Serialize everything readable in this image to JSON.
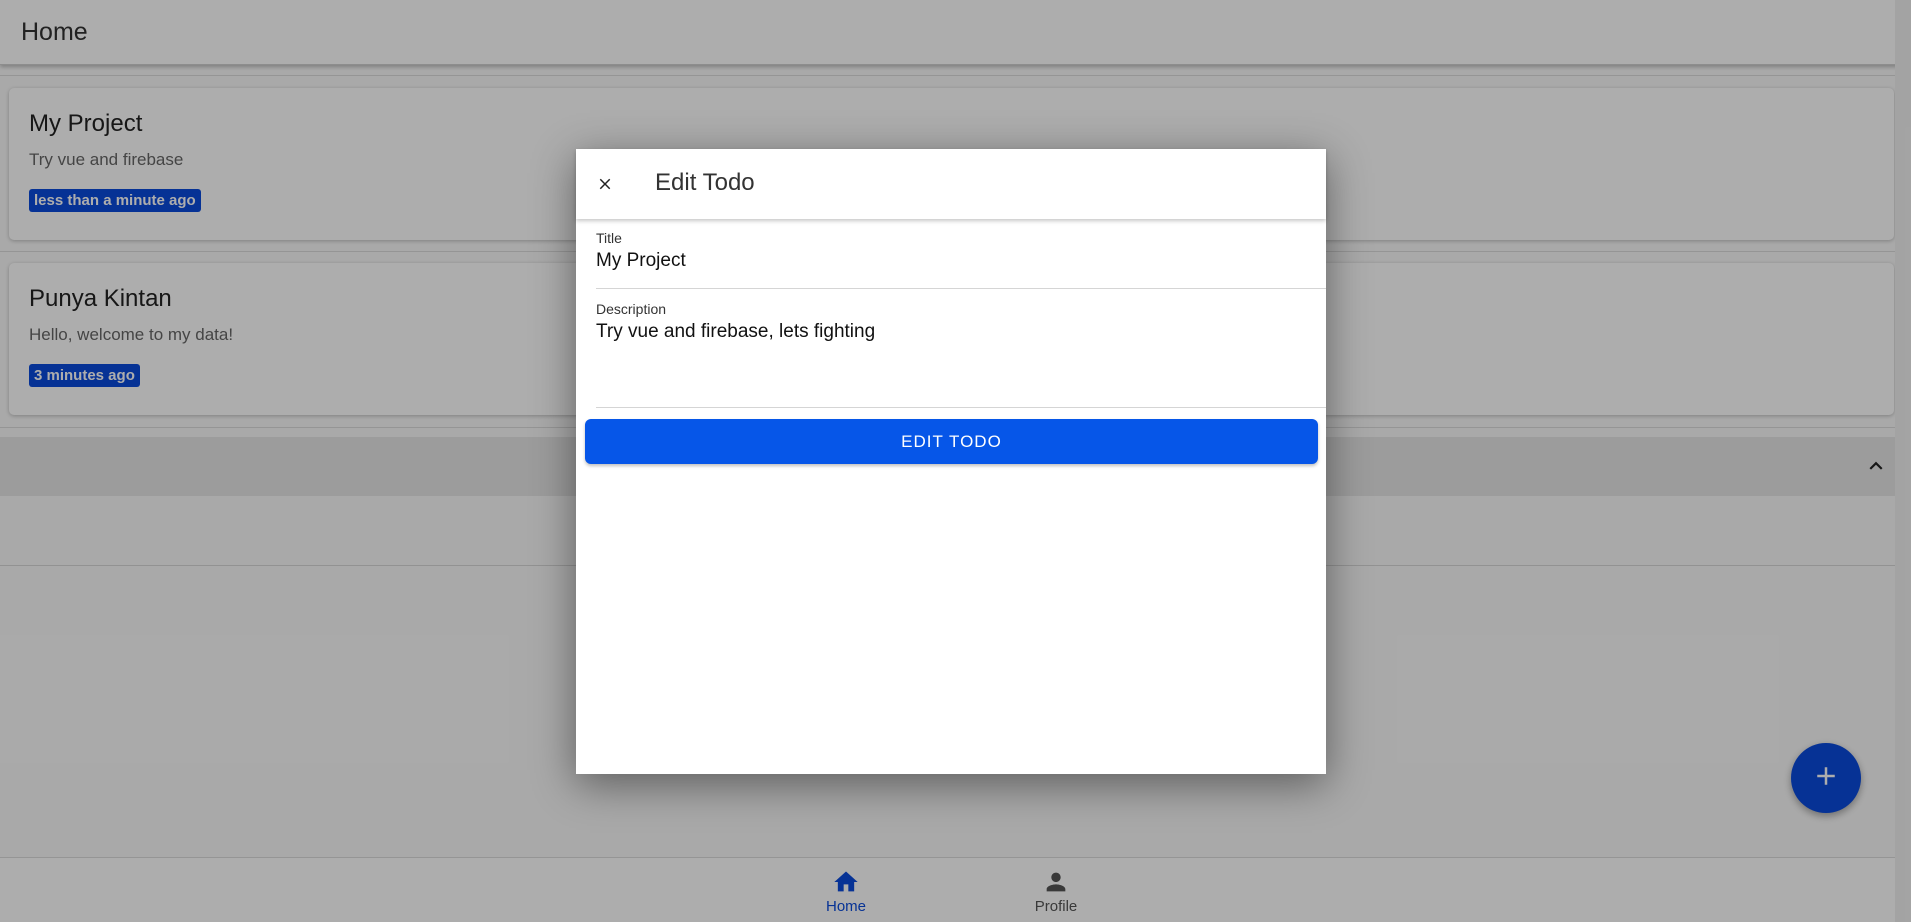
{
  "appbar": {
    "title": "Home"
  },
  "todos": [
    {
      "title": "My Project",
      "description": "Try vue and firebase",
      "time": "less than a minute ago"
    },
    {
      "title": "Punya Kintan",
      "description": "Hello, welcome to my data!",
      "time": "3 minutes ago"
    }
  ],
  "dialog": {
    "title": "Edit Todo",
    "fields": {
      "title_label": "Title",
      "title_value": "My Project",
      "description_label": "Description",
      "description_value": "Try vue and firebase, lets fighting"
    },
    "submit_label": "EDIT TODO"
  },
  "bottom_nav": [
    {
      "label": "Home",
      "icon": "home-icon",
      "active": true
    },
    {
      "label": "Profile",
      "icon": "person-icon",
      "active": false
    }
  ],
  "fab": {
    "icon": "plus-icon"
  },
  "colors": {
    "primary": "#0656e8",
    "badge": "#0a4bdc",
    "active_nav": "#0a4bdc",
    "inactive_nav": "#555555"
  }
}
